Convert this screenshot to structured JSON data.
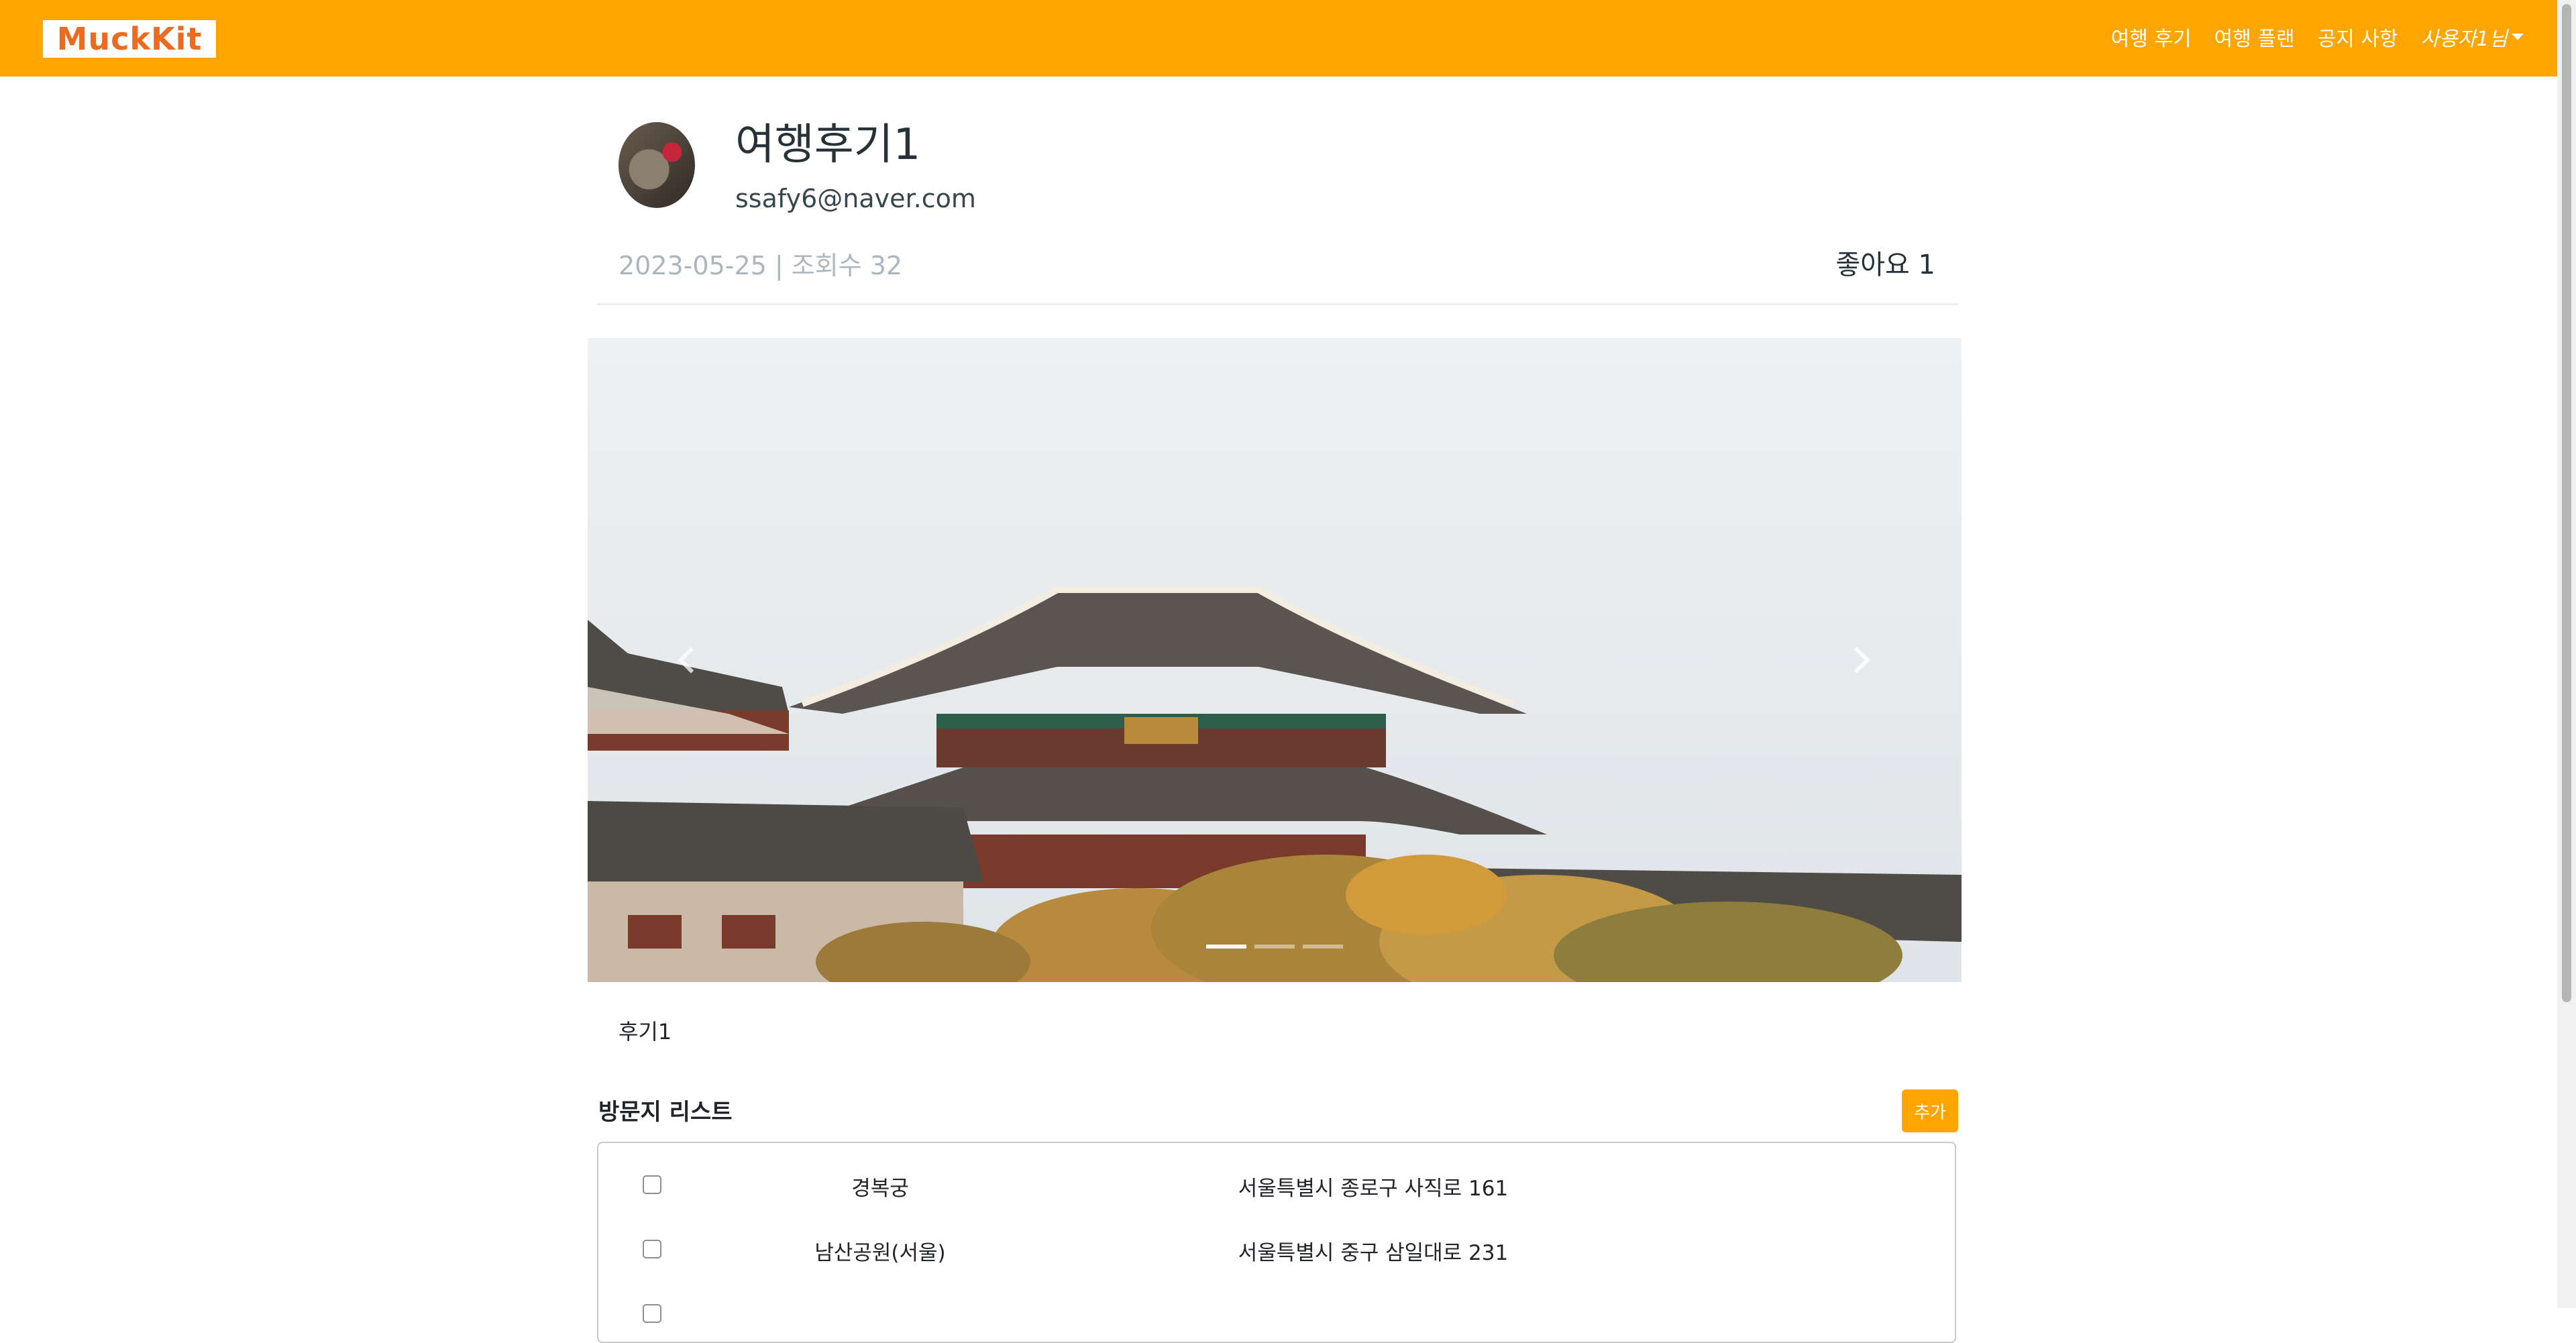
{
  "navbar": {
    "logo": "MuckKit",
    "links": [
      "여행 후기",
      "여행 플랜",
      "공지 사항"
    ],
    "user": "사용자1님",
    "color": "#ffa500"
  },
  "post": {
    "title": "여행후기1",
    "email": "ssafy6@naver.com",
    "meta": "2023-05-25 | 조회수 32",
    "likes": "좋아요 1",
    "body": "후기1"
  },
  "carousel": {
    "image": "palace-photo",
    "prev_icon": "chevron-left-icon",
    "next_icon": "chevron-right-icon",
    "indicators": [
      true,
      false,
      false
    ]
  },
  "visits": {
    "title": "방문지 리스트",
    "add_label": "추가",
    "items": [
      {
        "name": "경복궁",
        "address": "서울특별시 종로구 사직로 161"
      },
      {
        "name": "남산공원(서울)",
        "address": "서울특별시 중구 삼일대로 231"
      }
    ]
  }
}
